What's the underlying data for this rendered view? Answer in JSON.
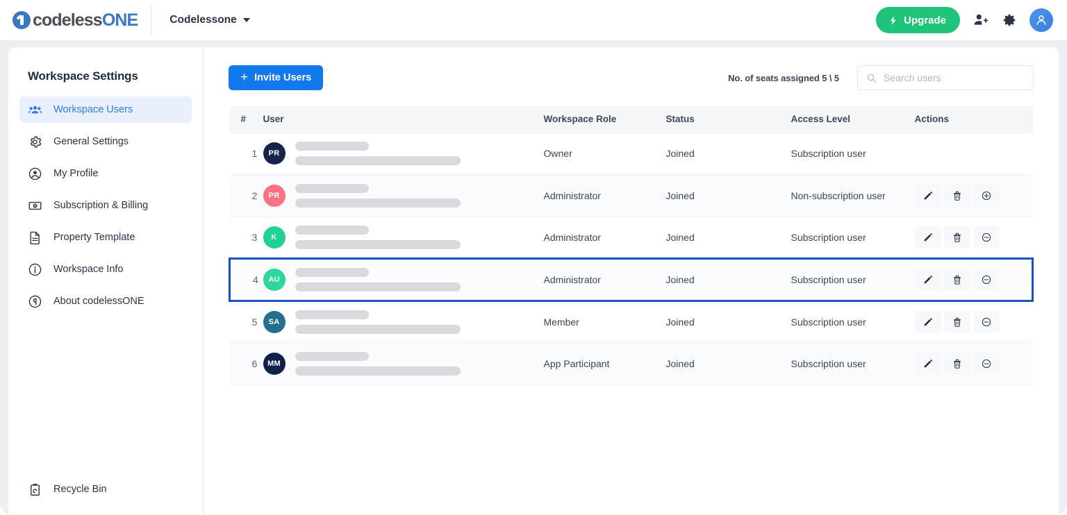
{
  "header": {
    "logo_text_1": "codeless",
    "logo_text_2": "ONE",
    "logo_icon": "codeless-one-logo-icon",
    "workspace_name": "Codelessone",
    "upgrade_label": "Upgrade",
    "upgrade_icon": "bolt-icon",
    "invite_people_icon": "person-add-icon",
    "settings_icon": "gear-icon",
    "account_icon": "user-avatar-icon",
    "accent_green": "#1ec47a",
    "accent_blue": "#1279ec"
  },
  "sidebar": {
    "title": "Workspace Settings",
    "items": [
      {
        "label": "Workspace Users",
        "icon": "people-group-icon",
        "active": true
      },
      {
        "label": "General Settings",
        "icon": "gear-icon",
        "active": false
      },
      {
        "label": "My Profile",
        "icon": "user-circle-icon",
        "active": false
      },
      {
        "label": "Subscription & Billing",
        "icon": "banknote-icon",
        "active": false
      },
      {
        "label": "Property Template",
        "icon": "document-icon",
        "active": false
      },
      {
        "label": "Workspace Info",
        "icon": "info-circle-icon",
        "active": false
      },
      {
        "label": "About codelessONE",
        "icon": "about-logo-icon",
        "active": false
      }
    ],
    "bottom_item": {
      "label": "Recycle Bin",
      "icon": "recycle-bin-icon"
    }
  },
  "toolbar": {
    "invite_label": "Invite Users",
    "invite_icon": "plus-icon",
    "seats_text": "No. of seats assigned 5 \\ 5",
    "search_placeholder": "Search users",
    "search_value": "",
    "search_icon": "search-icon"
  },
  "table": {
    "columns": [
      "#",
      "User",
      "Workspace Role",
      "Status",
      "Access Level",
      "Actions"
    ],
    "rows": [
      {
        "num": "1",
        "initials": "PR",
        "avatar_color": "#17234d",
        "role": "Owner",
        "status": "Joined",
        "access": "Subscription user",
        "actions": []
      },
      {
        "num": "2",
        "initials": "PR",
        "avatar_color": "#fc7183",
        "role": "Administrator",
        "status": "Joined",
        "access": "Non-subscription user",
        "actions": [
          "edit-icon",
          "delete-icon",
          "add-to-subscription-icon"
        ]
      },
      {
        "num": "3",
        "initials": "K",
        "avatar_color": "#1fd391",
        "role": "Administrator",
        "status": "Joined",
        "access": "Subscription user",
        "actions": [
          "edit-icon",
          "delete-icon",
          "remove-from-subscription-icon"
        ]
      },
      {
        "num": "4",
        "initials": "AU",
        "avatar_color": "#2bd89a",
        "role": "Administrator",
        "status": "Joined",
        "access": "Subscription user",
        "actions": [
          "edit-icon",
          "delete-icon",
          "remove-from-subscription-icon"
        ],
        "selected": true
      },
      {
        "num": "5",
        "initials": "SA",
        "avatar_color": "#236f92",
        "role": "Member",
        "status": "Joined",
        "access": "Subscription user",
        "actions": [
          "edit-icon",
          "delete-icon",
          "remove-from-subscription-icon"
        ]
      },
      {
        "num": "6",
        "initials": "MM",
        "avatar_color": "#13204a",
        "role": "App Participant",
        "status": "Joined",
        "access": "Subscription user",
        "actions": [
          "edit-icon",
          "delete-icon",
          "remove-from-subscription-icon"
        ]
      }
    ],
    "selected_row_border_color": "#1552c4",
    "user_names_redacted": true
  }
}
